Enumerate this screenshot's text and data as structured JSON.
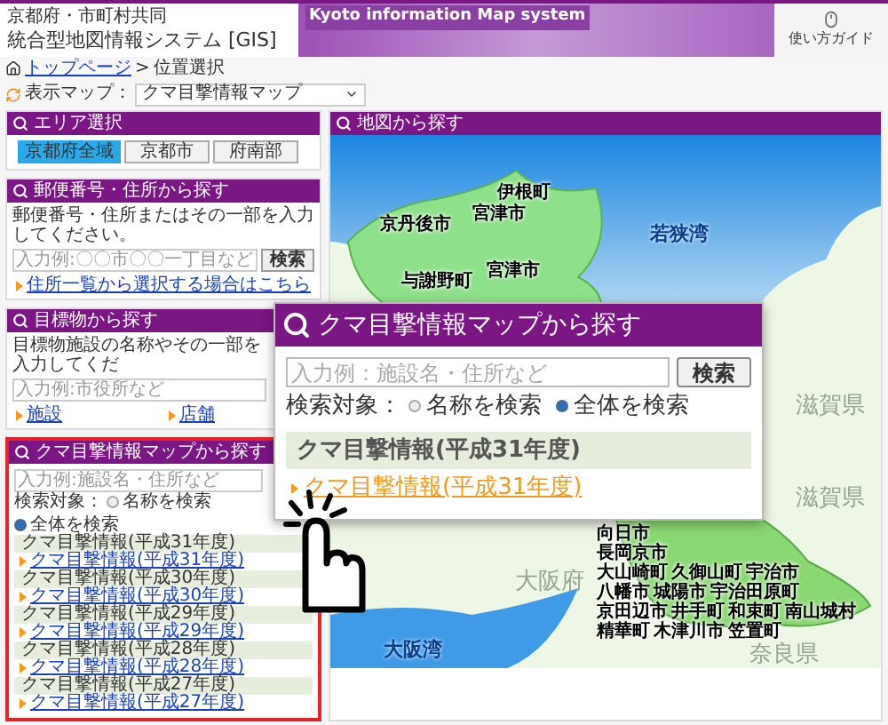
{
  "header": {
    "org": "京都府・市町村共同",
    "title": "統合型地図情報システム [GIS]",
    "banner": "Kyoto information Map system",
    "guide_button": "使い方ガイド"
  },
  "breadcrumb": {
    "link": "トップページ",
    "separator": ">",
    "current": "位置選択"
  },
  "map_select": {
    "label": "表示マップ：",
    "value": "クマ目撃情報マップ"
  },
  "area_panel": {
    "title": "エリア選択",
    "buttons": [
      {
        "label": "京都府全域",
        "selected": true
      },
      {
        "label": "京都市",
        "selected": false
      },
      {
        "label": "府南部",
        "selected": false
      }
    ]
  },
  "address_panel": {
    "title": "郵便番号・住所から探す",
    "instruction": "郵便番号・住所またはその一部を入力してください。",
    "placeholder": "入力例:〇〇市〇〇一丁目など",
    "search_button": "検索",
    "link": "住所一覧から選択する場合はこちら"
  },
  "landmark_panel": {
    "title": "目標物から探す",
    "instruction": "目標物施設の名称やその一部を入力してくだ",
    "placeholder": "入力例:市役所など",
    "links": [
      "施設",
      "店舗"
    ]
  },
  "bear_panel": {
    "title": "クマ目撃情報マップから探す",
    "highlighted": true,
    "placeholder": "入力例:施設名・住所など",
    "scope_label": "検索対象：",
    "scopes": [
      {
        "label": "名称を検索",
        "selected": false
      },
      {
        "label": "全体を検索",
        "selected": true
      }
    ],
    "groups": [
      {
        "heading": "クマ目撃情報(平成31年度)",
        "link": "クマ目撃情報(平成31年度)"
      },
      {
        "heading": "クマ目撃情報(平成30年度)",
        "link": "クマ目撃情報(平成30年度)"
      },
      {
        "heading": "クマ目撃情報(平成29年度)",
        "link": "クマ目撃情報(平成29年度)"
      },
      {
        "heading": "クマ目撃情報(平成28年度)",
        "link": "クマ目撃情報(平成28年度)"
      },
      {
        "heading": "クマ目撃情報(平成27年度)",
        "link": "クマ目撃情報(平成27年度)"
      }
    ]
  },
  "map_panel": {
    "title": "地図から探す",
    "labels": [
      {
        "text": "伊根町",
        "kind": "place"
      },
      {
        "text": "宮津市",
        "kind": "place"
      },
      {
        "text": "京丹後市",
        "kind": "place"
      },
      {
        "text": "与謝野町",
        "kind": "place"
      },
      {
        "text": "宮津市",
        "kind": "place"
      },
      {
        "text": "若狭湾",
        "kind": "sea"
      },
      {
        "text": "滋賀県",
        "kind": "region"
      },
      {
        "text": "滋賀県",
        "kind": "region"
      },
      {
        "text": "大阪府",
        "kind": "region"
      },
      {
        "text": "大阪湾",
        "kind": "sea"
      },
      {
        "text": "奈良県",
        "kind": "region"
      }
    ],
    "city_rows": [
      [
        "向日市"
      ],
      [
        "長岡京市"
      ],
      [
        "大山崎町",
        "久御山町",
        "宇治市"
      ],
      [
        "八幡市",
        "城陽市",
        "宇治田原町"
      ],
      [
        "京田辺市",
        "井手町",
        "和束町",
        "南山城村"
      ],
      [
        "精華町",
        "木津川市",
        "笠置町"
      ]
    ]
  },
  "popup": {
    "title": "クマ目撃情報マップから探す",
    "placeholder": "入力例：施設名・住所など",
    "search_button": "検索",
    "scope_label": "検索対象：",
    "scopes": [
      {
        "label": "名称を検索",
        "selected": false
      },
      {
        "label": "全体を検索",
        "selected": true
      }
    ],
    "group_heading": "クマ目撃情報(平成31年度)",
    "link": "クマ目撃情報(平成31年度)"
  }
}
